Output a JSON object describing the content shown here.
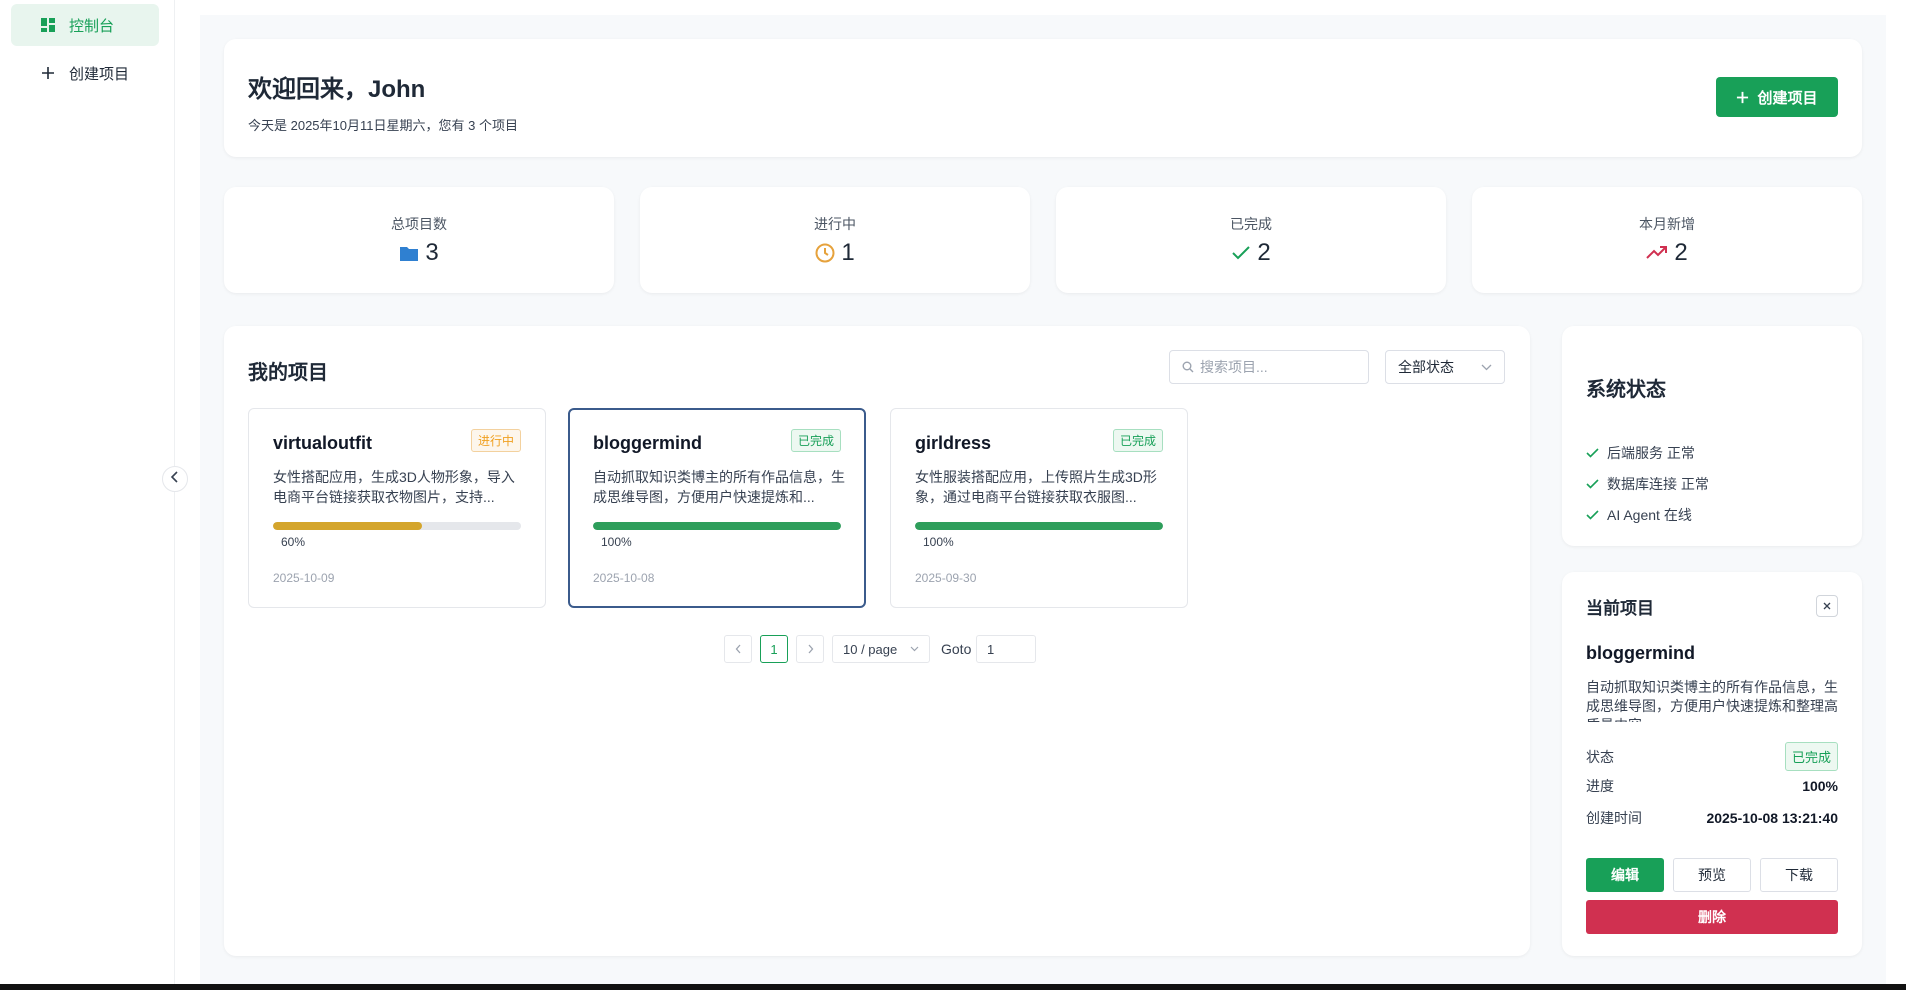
{
  "sidebar": {
    "items": [
      {
        "label": "控制台",
        "icon": "dashboard-icon",
        "active": true
      },
      {
        "label": "创建项目",
        "icon": "plus-icon",
        "active": false
      }
    ]
  },
  "welcome": {
    "title": "欢迎回来，John",
    "subtitle": "今天是 2025年10月11日星期六，您有 3 个项目",
    "create_button": "创建项目"
  },
  "stats": [
    {
      "label": "总项目数",
      "value": "3",
      "icon": "folder-icon",
      "color": "#2f80d1"
    },
    {
      "label": "进行中",
      "value": "1",
      "icon": "clock-icon",
      "color": "#e6a23c"
    },
    {
      "label": "已完成",
      "value": "2",
      "icon": "check-icon",
      "color": "#18a058"
    },
    {
      "label": "本月新增",
      "value": "2",
      "icon": "trending-up-icon",
      "color": "#d03050"
    }
  ],
  "projects": {
    "title": "我的项目",
    "search_placeholder": "搜索项目...",
    "filter_selected": "全部状态",
    "cards": [
      {
        "name": "virtualoutfit",
        "status": "进行中",
        "status_color": "orange",
        "desc": "女性搭配应用，生成3D人物形象，导入电商平台链接获取衣物图片，支持...",
        "progress": 60,
        "progress_label": "60%",
        "progress_color": "#d4a52c",
        "date": "2025-10-09",
        "selected": false
      },
      {
        "name": "bloggermind",
        "status": "已完成",
        "status_color": "green",
        "desc": "自动抓取知识类博主的所有作品信息，生成思维导图，方便用户快速提炼和...",
        "progress": 100,
        "progress_label": "100%",
        "progress_color": "#2e9e5b",
        "date": "2025-10-08",
        "selected": true
      },
      {
        "name": "girldress",
        "status": "已完成",
        "status_color": "green",
        "desc": "女性服装搭配应用，上传照片生成3D形象，通过电商平台链接获取衣服图...",
        "progress": 100,
        "progress_label": "100%",
        "progress_color": "#2e9e5b",
        "date": "2025-09-30",
        "selected": false
      }
    ],
    "pagination": {
      "current_page": "1",
      "page_size": "10 / page",
      "goto_label": "Goto",
      "goto_value": "1"
    }
  },
  "system_status": {
    "title": "系统状态",
    "items": [
      {
        "label": "后端服务 正常"
      },
      {
        "label": "数据库连接 正常"
      },
      {
        "label": "AI Agent 在线"
      }
    ]
  },
  "current_project": {
    "title": "当前项目",
    "name": "bloggermind",
    "desc": "自动抓取知识类博主的所有作品信息，生成思维导图，方便用户快速提炼和整理高质量内容",
    "status_label": "状态",
    "status_value": "已完成",
    "progress_label": "进度",
    "progress_value": "100%",
    "created_label": "创建时间",
    "created_value": "2025-10-08 13:21:40",
    "buttons": {
      "edit": "编辑",
      "preview": "预览",
      "download": "下载",
      "delete": "删除"
    }
  },
  "colors": {
    "accent": "#18a058",
    "danger": "#d03050"
  }
}
